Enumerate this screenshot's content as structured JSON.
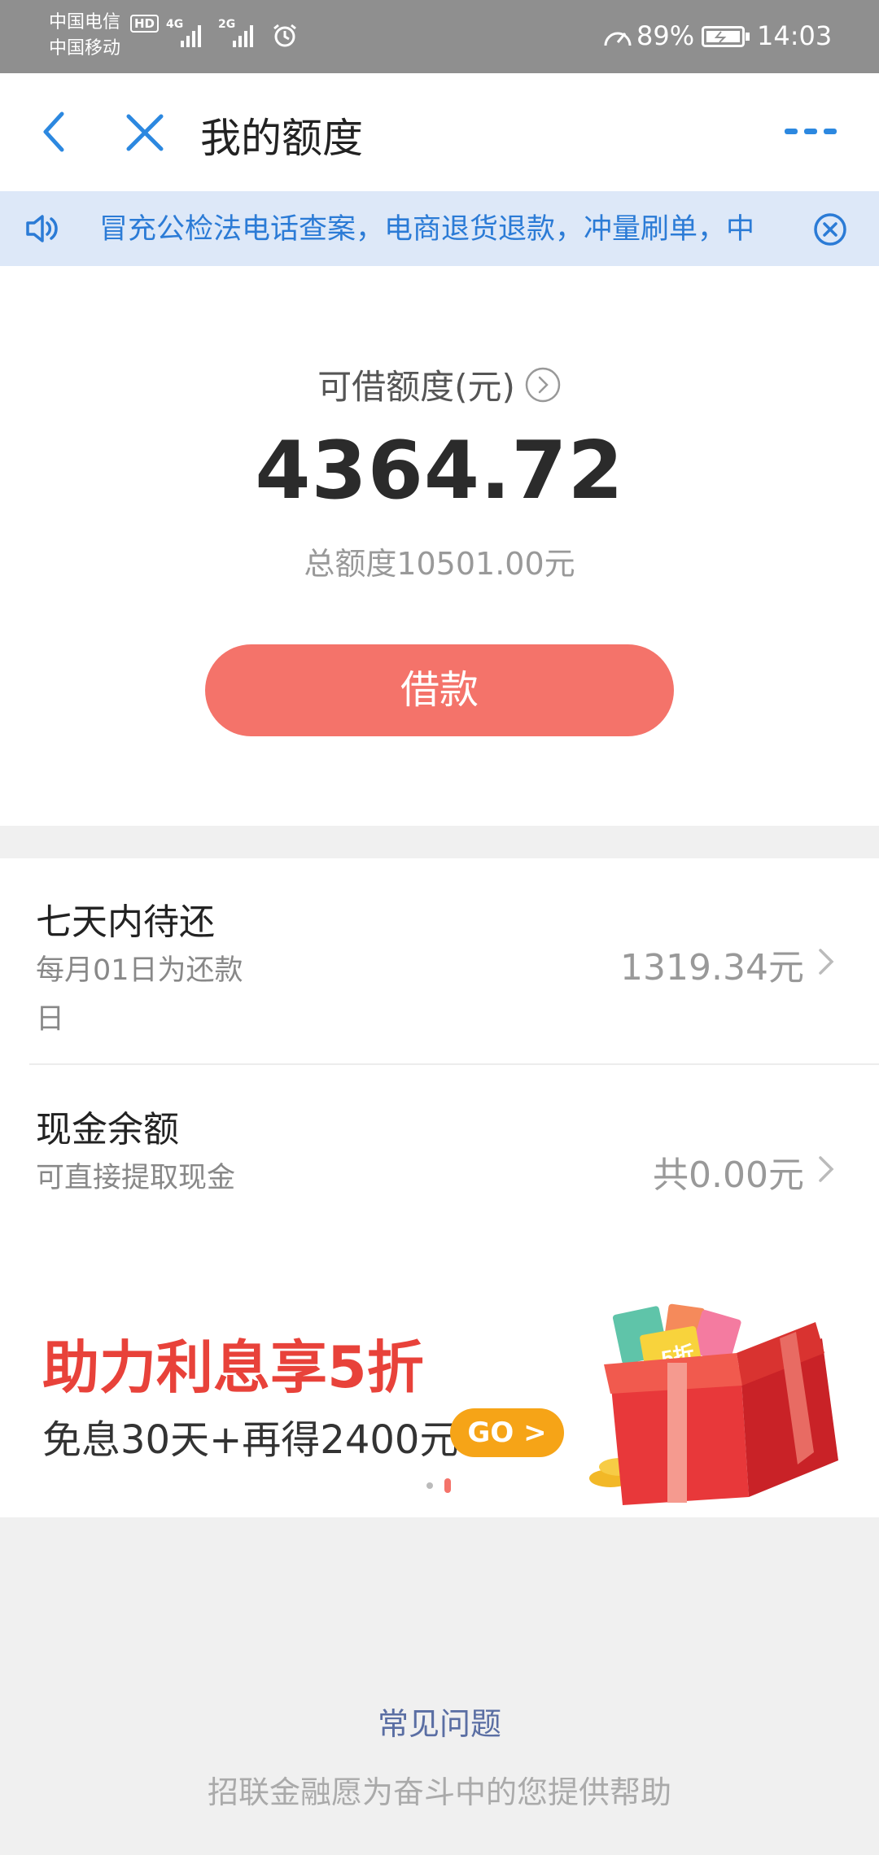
{
  "status_bar": {
    "carrier_1": "中国电信",
    "carrier_2": "中国移动",
    "hd_badge": "HD",
    "network_1": "4G",
    "network_2": "2G",
    "battery": "89%",
    "time": "14:03"
  },
  "navbar": {
    "title": "我的额度"
  },
  "notice": {
    "text": "冒充公检法电话查案，电商退货退款，冲量刷单，中"
  },
  "quota": {
    "label": "可借额度(元)",
    "amount": "4364.72",
    "total": "总额度10501.00元",
    "borrow_label": "借款"
  },
  "list": {
    "items": [
      {
        "title": "七天内待还",
        "subtitle": "每月01日为还款日",
        "value": "1319.34元"
      },
      {
        "title": "现金余额",
        "subtitle": "可直接提取现金",
        "value": "共0.00元"
      }
    ]
  },
  "banner": {
    "headline": "助力利息享5折",
    "subline": "免息30天+再得2400元",
    "go_label": "GO >",
    "gift_label": "5折"
  },
  "footer": {
    "faq": "常见问题",
    "slogan": "招联金融愿为奋斗中的您提供帮助"
  },
  "colors": {
    "accent_red": "#f4736a",
    "headline_red": "#e8423a",
    "notice_blue": "#2b7bd6",
    "go_orange": "#f6a417"
  },
  "icons": [
    "back-icon",
    "close-icon",
    "more-icon",
    "speaker-icon",
    "notice-close-icon",
    "info-icon",
    "chevron-right-icon",
    "alarm-icon",
    "battery-icon"
  ]
}
